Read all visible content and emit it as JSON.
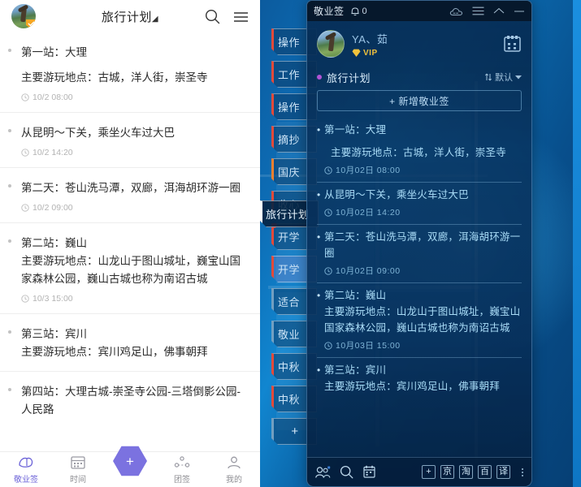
{
  "mobile": {
    "header": {
      "title": "旅行计划",
      "caret": "◢",
      "search_icon": "search-icon",
      "menu_icon": "menu-icon"
    },
    "items": [
      {
        "title": "第一站：大理",
        "sub": "主要游玩地点：古城，洋人街，崇圣寺",
        "spaced": true,
        "time": "10/2 08:00"
      },
      {
        "title": "从昆明～下关，乘坐火车过大巴",
        "sub": "",
        "spaced": false,
        "time": "10/2 14:20"
      },
      {
        "title": "第二天：苍山洗马潭，双廊，洱海胡环游一圈",
        "sub": "",
        "spaced": false,
        "time": "10/2 09:00"
      },
      {
        "title": "第二站：巍山",
        "sub": "主要游玩地点：山龙山于图山城址，巍宝山国家森林公园，巍山古城也称为南诏古城",
        "spaced": false,
        "time": "10/3 15:00"
      },
      {
        "title": "第三站：宾川",
        "sub": "主要游玩地点：宾川鸡足山，佛事朝拜",
        "spaced": false,
        "time": ""
      },
      {
        "title": "第四站：大理古城-崇圣寺公园-三塔倒影公园-人民路",
        "sub": "",
        "spaced": false,
        "time": ""
      }
    ],
    "tabbar": [
      {
        "label": "敬业签",
        "icon": "note-icon",
        "active": true
      },
      {
        "label": "时间",
        "icon": "calendar-icon",
        "active": false
      },
      {
        "label": "",
        "icon": "plus-icon",
        "active": false
      },
      {
        "label": "团签",
        "icon": "group-icon",
        "active": false
      },
      {
        "label": "我的",
        "icon": "person-icon",
        "active": false
      }
    ],
    "add_button_label": "+"
  },
  "desktop": {
    "note_tabs": [
      {
        "label": "操作",
        "accent": "red",
        "dot": false
      },
      {
        "label": "工作",
        "accent": "red",
        "dot": false
      },
      {
        "label": "操作",
        "accent": "red",
        "dot": false
      },
      {
        "label": "摘抄",
        "accent": "red",
        "dot": false
      },
      {
        "label": "国庆",
        "accent": "orange",
        "dot": false
      },
      {
        "label": "收心",
        "accent": "red",
        "dot": false
      },
      {
        "label": "开学",
        "accent": "red",
        "dot": true
      },
      {
        "label": "开学",
        "accent": "red",
        "dot": false,
        "selected": true
      },
      {
        "label": "适合",
        "accent": "plain",
        "dot": false
      },
      {
        "label": "敬业",
        "accent": "plain",
        "dot": false
      },
      {
        "label": "中秋",
        "accent": "red",
        "dot": false
      },
      {
        "label": "中秋",
        "accent": "red",
        "dot": false
      },
      {
        "label": "+",
        "accent": "plain",
        "dot": false,
        "add": true
      }
    ],
    "active_tab_label": "旅行计划"
  },
  "window": {
    "titlebar": {
      "brand": "敬业签",
      "notification_count": "0",
      "bell_icon": "bell-icon",
      "cloud_icon": "cloud-icon",
      "menu_icon": "menu-icon",
      "collapse_icon": "chevron-up-icon",
      "minimize_icon": "minimize-icon"
    },
    "user": {
      "name": "YA、茹",
      "vip_label": "VIP",
      "vip_icon": "diamond-icon",
      "avatar_icon": "user-avatar",
      "calendar_icon": "calendar-icon"
    },
    "category": {
      "name": "旅行计划",
      "dot_color": "#b254d6",
      "sort_label": "默认",
      "sort_icon": "sort-icon",
      "chevron_icon": "chevron-down-icon"
    },
    "add_note_label": "+ 新增敬业签",
    "items": [
      {
        "title": "第一站：大理",
        "sub": "主要游玩地点：古城，洋人街，崇圣寺",
        "spaced": true,
        "time": "10月02日  08:00"
      },
      {
        "title": "从昆明～下关，乘坐火车过大巴",
        "sub": "",
        "spaced": false,
        "time": "10月02日  14:20"
      },
      {
        "title": "第二天：苍山洗马潭，双廊，洱海胡环游一圈",
        "sub": "",
        "spaced": false,
        "time": "10月02日  09:00"
      },
      {
        "title": "第二站：巍山",
        "sub": "主要游玩地点：山龙山于图山城址，巍宝山国家森林公园，巍山古城也称为南诏古城",
        "spaced": false,
        "time": "10月03日  15:00"
      },
      {
        "title": "第三站：宾川",
        "sub": "主要游玩地点：宾川鸡足山，佛事朝拜",
        "spaced": false,
        "time": ""
      }
    ],
    "bottombar": {
      "left_icons": [
        {
          "name": "contacts-icon"
        },
        {
          "name": "search-icon"
        },
        {
          "name": "calendar-icon"
        }
      ],
      "buttons": [
        "+",
        "京",
        "淘",
        "百",
        "译"
      ],
      "more_icon": "more-vertical-icon"
    }
  }
}
